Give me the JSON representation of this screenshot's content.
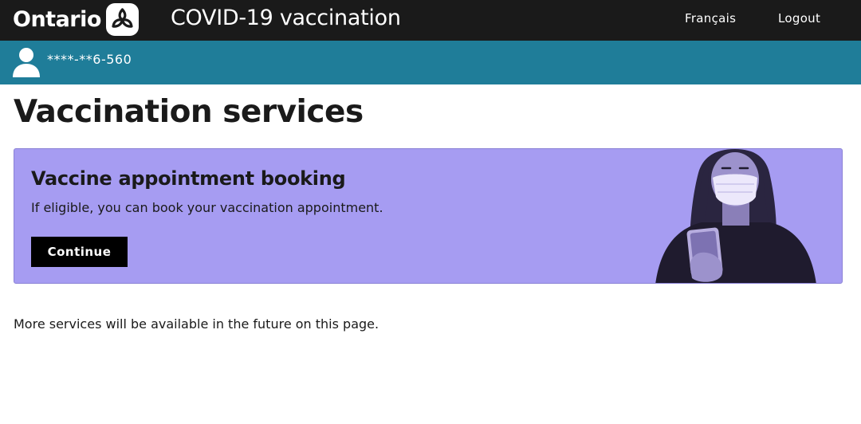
{
  "header": {
    "logo_text": "Ontario",
    "logo_icon": "ontario-trillium-icon",
    "app_title": "COVID-19 vaccination",
    "nav": {
      "language_label": "Français",
      "logout_label": "Logout"
    },
    "colors": {
      "background": "#1a1a1a",
      "text": "#ffffff"
    }
  },
  "user_bar": {
    "icon": "user-icon",
    "masked_health_card": "****-**6-560",
    "color": "#1f7d99"
  },
  "main": {
    "page_title": "Vaccination services",
    "card": {
      "heading": "Vaccine appointment booking",
      "description": "If eligible, you can book your vaccination appointment.",
      "button_label": "Continue",
      "color": "#a69cf2"
    },
    "footer_note": "More services will be available in the future on this page."
  }
}
